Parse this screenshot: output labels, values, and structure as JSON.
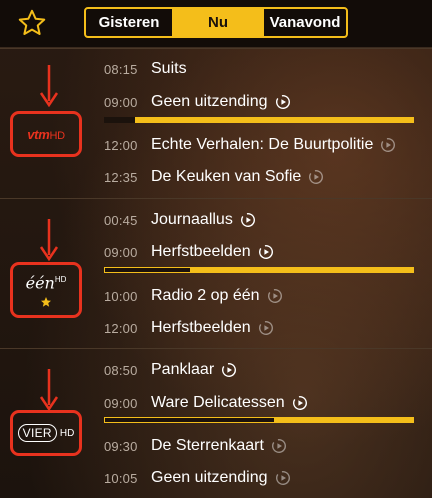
{
  "header": {
    "favorites_icon": "star-outline-icon",
    "tabs": [
      {
        "label": "Gisteren",
        "active": false
      },
      {
        "label": "Nu",
        "active": true
      },
      {
        "label": "Vanavond",
        "active": false
      }
    ]
  },
  "colors": {
    "accent": "#f4be1a",
    "highlight": "#e8321e",
    "background": "#231710"
  },
  "channels": [
    {
      "logo": {
        "text": "vtm",
        "suffix": "HD"
      },
      "favorite": false,
      "programs": [
        {
          "time": "08:15",
          "title": "Suits",
          "play": false
        },
        {
          "time": "09:00",
          "title": "Geen uitzending",
          "play": true,
          "current": true,
          "progress": 0.1
        },
        {
          "time": "12:00",
          "title": "Echte Verhalen: De Buurtpolitie",
          "play": true
        },
        {
          "time": "12:35",
          "title": "De Keuken van Sofie",
          "play": true
        }
      ]
    },
    {
      "logo": {
        "text": "één",
        "suffix": "HD"
      },
      "favorite": true,
      "programs": [
        {
          "time": "00:45",
          "title": "Journaallus",
          "play": true
        },
        {
          "time": "09:00",
          "title": "Herfstbeelden",
          "play": true,
          "current": true,
          "progress": 0.28
        },
        {
          "time": "10:00",
          "title": "Radio 2 op één",
          "play": true
        },
        {
          "time": "12:00",
          "title": "Herfstbeelden",
          "play": true
        }
      ]
    },
    {
      "logo": {
        "text": "VIER",
        "suffix": "HD"
      },
      "favorite": false,
      "programs": [
        {
          "time": "08:50",
          "title": "Panklaar",
          "play": true
        },
        {
          "time": "09:00",
          "title": "Ware Delicatessen",
          "play": true,
          "current": true,
          "progress": 0.55
        },
        {
          "time": "09:30",
          "title": "De Sterrenkaart",
          "play": true
        },
        {
          "time": "10:05",
          "title": "Geen uitzending",
          "play": true
        }
      ]
    }
  ]
}
